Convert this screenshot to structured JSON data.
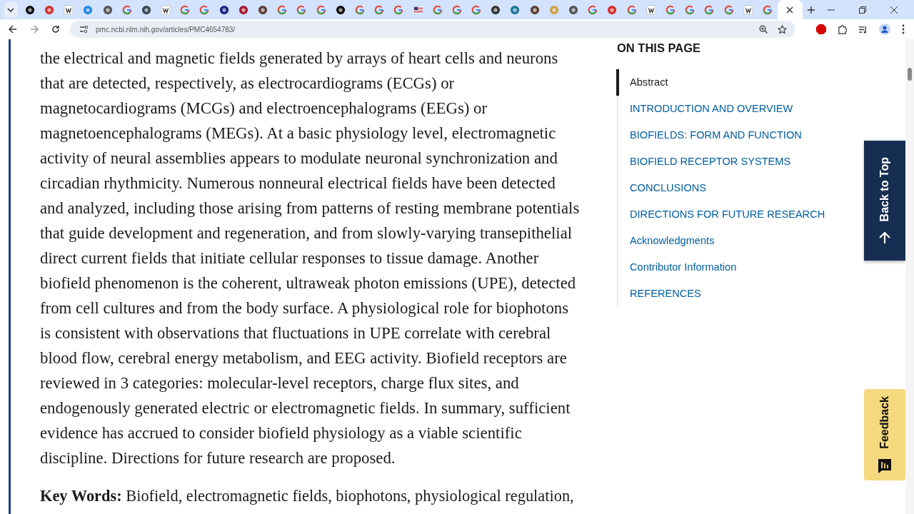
{
  "browser": {
    "tabs": [
      {
        "kind": "dark",
        "selected": false
      },
      {
        "kind": "red",
        "selected": false
      },
      {
        "kind": "letter",
        "selected": false
      },
      {
        "kind": "link",
        "selected": false
      },
      {
        "kind": "globe",
        "selected": false
      },
      {
        "kind": "google",
        "selected": false
      },
      {
        "kind": "tag",
        "selected": false
      },
      {
        "kind": "letter",
        "selected": false
      },
      {
        "kind": "google",
        "selected": false
      },
      {
        "kind": "google",
        "selected": false
      },
      {
        "kind": "bird",
        "selected": false
      },
      {
        "kind": "shield",
        "selected": false
      },
      {
        "kind": "seal",
        "selected": false
      },
      {
        "kind": "google",
        "selected": false
      },
      {
        "kind": "google",
        "selected": false
      },
      {
        "kind": "google",
        "selected": false
      },
      {
        "kind": "dark",
        "selected": false
      },
      {
        "kind": "google",
        "selected": false
      },
      {
        "kind": "google",
        "selected": false
      },
      {
        "kind": "google",
        "selected": false
      },
      {
        "kind": "flag",
        "selected": false
      },
      {
        "kind": "google",
        "selected": false
      },
      {
        "kind": "google",
        "selected": false
      },
      {
        "kind": "google",
        "selected": false
      },
      {
        "kind": "gear",
        "selected": false
      },
      {
        "kind": "wp",
        "selected": false
      },
      {
        "kind": "seal",
        "selected": false
      },
      {
        "kind": "photo",
        "selected": false
      },
      {
        "kind": "globe",
        "selected": false
      },
      {
        "kind": "google",
        "selected": false
      },
      {
        "kind": "red",
        "selected": false
      },
      {
        "kind": "google",
        "selected": false
      },
      {
        "kind": "letter",
        "selected": false
      },
      {
        "kind": "google",
        "selected": false
      },
      {
        "kind": "google",
        "selected": false
      },
      {
        "kind": "google",
        "selected": false
      },
      {
        "kind": "google",
        "selected": false
      },
      {
        "kind": "letter",
        "selected": false
      },
      {
        "kind": "google",
        "selected": false
      },
      {
        "kind": "close",
        "selected": true
      }
    ],
    "url": "pmc.ncbi.nlm.nih.gov/articles/PMC4654783/"
  },
  "article": {
    "abstract": "the electrical and magnetic fields generated by arrays of heart cells and neurons that are detected, respectively, as electrocardiograms (ECGs) or magnetocardiograms (MCGs) and electroencephalograms (EEGs) or magnetoencephalograms (MEGs). At a basic physiology level, electromagnetic activity of neural assemblies appears to modulate neuronal synchronization and circadian rhythmicity. Numerous nonneural electrical fields have been detected and analyzed, including those arising from patterns of resting membrane potentials that guide development and regeneration, and from slowly-varying transepithelial direct current fields that initiate cellular responses to tissue damage. Another biofield phenomenon is the coherent, ultraweak photon emissions (UPE), detected from cell cultures and from the body surface. A physiological role for biophotons is consistent with observations that fluctuations in UPE correlate with cerebral blood flow, cerebral energy metabolism, and EEG activity. Biofield receptors are reviewed in 3 categories: molecular-level receptors, charge flux sites, and endogenously generated electric or electromagnetic fields. In summary, sufficient evidence has accrued to consider biofield physiology as a viable scientific discipline. Directions for future research are proposed.",
    "keywords": "**Key Words:** Biofield, electromagnetic fields, biophotons, physiological regulation,"
  },
  "toc": {
    "title": "ON THIS PAGE",
    "items": [
      {
        "label": "Abstract",
        "selected": true
      },
      {
        "label": "INTRODUCTION AND OVERVIEW",
        "selected": false
      },
      {
        "label": "BIOFIELDS: FORM AND FUNCTION",
        "selected": false
      },
      {
        "label": "BIOFIELD RECEPTOR SYSTEMS",
        "selected": false
      },
      {
        "label": "CONCLUSIONS",
        "selected": false
      },
      {
        "label": "DIRECTIONS FOR FUTURE RESEARCH",
        "selected": false
      },
      {
        "label": "Acknowledgments",
        "selected": false
      },
      {
        "label": "Contributor Information",
        "selected": false
      },
      {
        "label": "REFERENCES",
        "selected": false
      }
    ]
  },
  "back_to_top": "Back to Top",
  "feedback": "Feedback"
}
